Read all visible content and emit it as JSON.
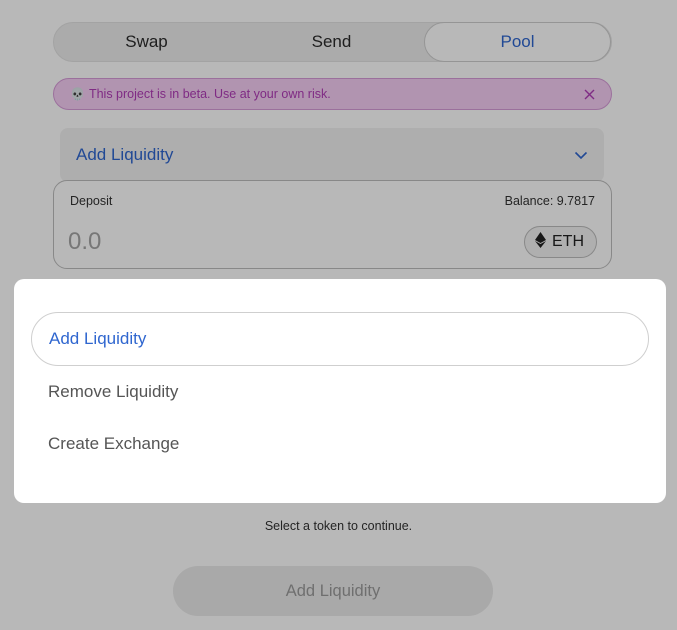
{
  "tabs": [
    {
      "label": "Swap",
      "active": false
    },
    {
      "label": "Send",
      "active": false
    },
    {
      "label": "Pool",
      "active": true
    }
  ],
  "banner": {
    "icon": "skull-icon",
    "text": "This project is in beta. Use at your own risk.",
    "close_icon": "close-icon"
  },
  "mode_select": {
    "value": "Add Liquidity",
    "icon": "chevron-down-icon"
  },
  "deposit": {
    "label": "Deposit",
    "balance": "Balance: 9.7817",
    "amount_placeholder": "0.0",
    "token": "ETH",
    "token_icon": "eth-icon"
  },
  "helper_text": "Select a token to continue.",
  "submit_label": "Add Liquidity",
  "modal": {
    "options": [
      {
        "label": "Add Liquidity",
        "selected": true
      },
      {
        "label": "Remove Liquidity",
        "selected": false
      },
      {
        "label": "Create Exchange",
        "selected": false
      }
    ]
  },
  "colors": {
    "accent": "#2f66cf",
    "banner_bg": "#f6cdf4",
    "banner_text": "#b13cb7"
  }
}
